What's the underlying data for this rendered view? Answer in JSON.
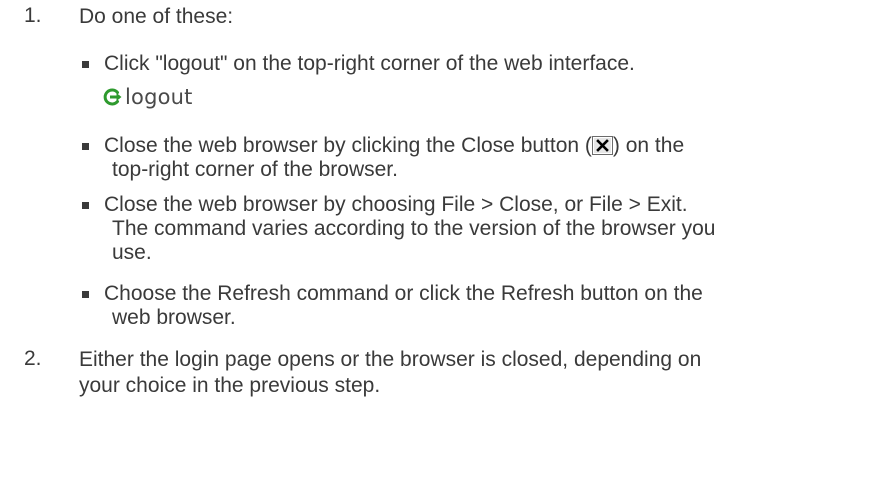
{
  "steps": [
    {
      "number": "1.",
      "intro": "Do one of these:",
      "bullets": [
        {
          "text": "Click \"logout\" on the top-right corner of the web interface."
        },
        {
          "text_before_icon": "Close the web browser by clicking the Close button (",
          "text_after_icon": ") on the",
          "continuation": "top-right corner of the browser."
        },
        {
          "line1": "Close the web browser by choosing File > Close, or File > Exit.",
          "line2": "The command varies according to the version of the browser you",
          "line3": "use."
        },
        {
          "line1": "Choose the Refresh command or click the Refresh button on the",
          "line2": "web browser."
        }
      ]
    },
    {
      "number": "2.",
      "line1": "Either the login page opens or the browser is closed, depending on",
      "line2": "your choice in the previous step."
    }
  ],
  "logout_link": {
    "label": "logout",
    "icon": "logout-arrow-icon",
    "icon_color": "#2e9a2e"
  },
  "close_button_icon": "close-x-icon"
}
